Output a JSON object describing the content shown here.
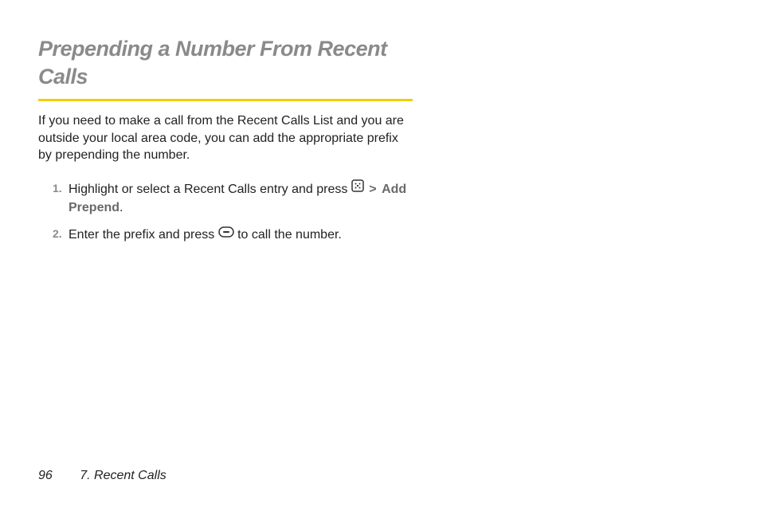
{
  "heading": "Prepending a Number From Recent Calls",
  "intro": "If you need to make a call from the Recent Calls List and you are outside your local area code, you can add the appropriate prefix by prepending the number.",
  "steps": {
    "s1": {
      "num": "1.",
      "text_before": "Highlight or select a Recent Calls entry and press ",
      "gt": ">",
      "bold": "Add Prepend",
      "period": "."
    },
    "s2": {
      "num": "2.",
      "text_before": "Enter the prefix and press ",
      "text_after": " to call the number."
    }
  },
  "footer": {
    "page": "96",
    "chapter": "7. Recent Calls"
  }
}
